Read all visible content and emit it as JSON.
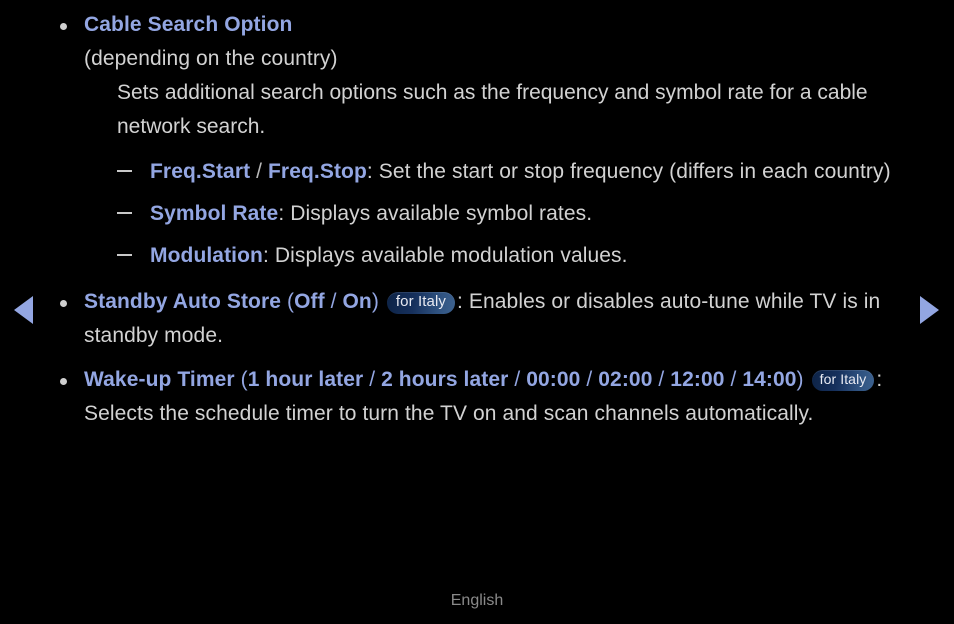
{
  "screen": {
    "background_color": "#000000",
    "body_text_color": "#d2d2d2",
    "keyword_color": "#93a6e2",
    "badge_gradient_from": "#0d2346",
    "badge_gradient_to": "#3d628f",
    "arrow_color": "#93a6e2"
  },
  "nav": {
    "prev_icon": "triangle-left-icon",
    "next_icon": "triangle-right-icon"
  },
  "footer": {
    "language_label": "English"
  },
  "sections": [
    {
      "id": "cable-search-option",
      "title": "Cable Search Option",
      "subtitle": "(depending on the country)",
      "description": "Sets additional search options such as the frequency and symbol rate for a cable network search.",
      "sub_items": [
        {
          "id": "freq-start-stop",
          "term_a": "Freq.Start",
          "separator": " / ",
          "term_b": "Freq.Stop",
          "colon": ": ",
          "description": "Set the start or stop frequency (differs in each country)"
        },
        {
          "id": "symbol-rate",
          "term_a": "Symbol Rate",
          "colon": ": ",
          "description": "Displays available symbol rates."
        },
        {
          "id": "modulation",
          "term_a": "Modulation",
          "colon": ": ",
          "description": "Displays available modulation values."
        }
      ]
    },
    {
      "id": "standby-auto-store",
      "title": "Standby Auto Store",
      "open_paren": " (",
      "options": [
        "Off",
        "On"
      ],
      "option_separator": " / ",
      "close_paren": ")",
      "badge": "for Italy",
      "colon": ": ",
      "description": "Enables or disables auto-tune while TV is in standby mode."
    },
    {
      "id": "wake-up-timer",
      "title": "Wake-up Timer",
      "open_paren": " (",
      "options": [
        "1 hour later",
        "2 hours later",
        "00:00",
        "02:00",
        "12:00",
        "14:00"
      ],
      "option_separator": " / ",
      "close_paren": ")",
      "badge": "for Italy",
      "colon": ": ",
      "description": "Selects the schedule timer to turn the TV on and scan channels automatically."
    }
  ]
}
